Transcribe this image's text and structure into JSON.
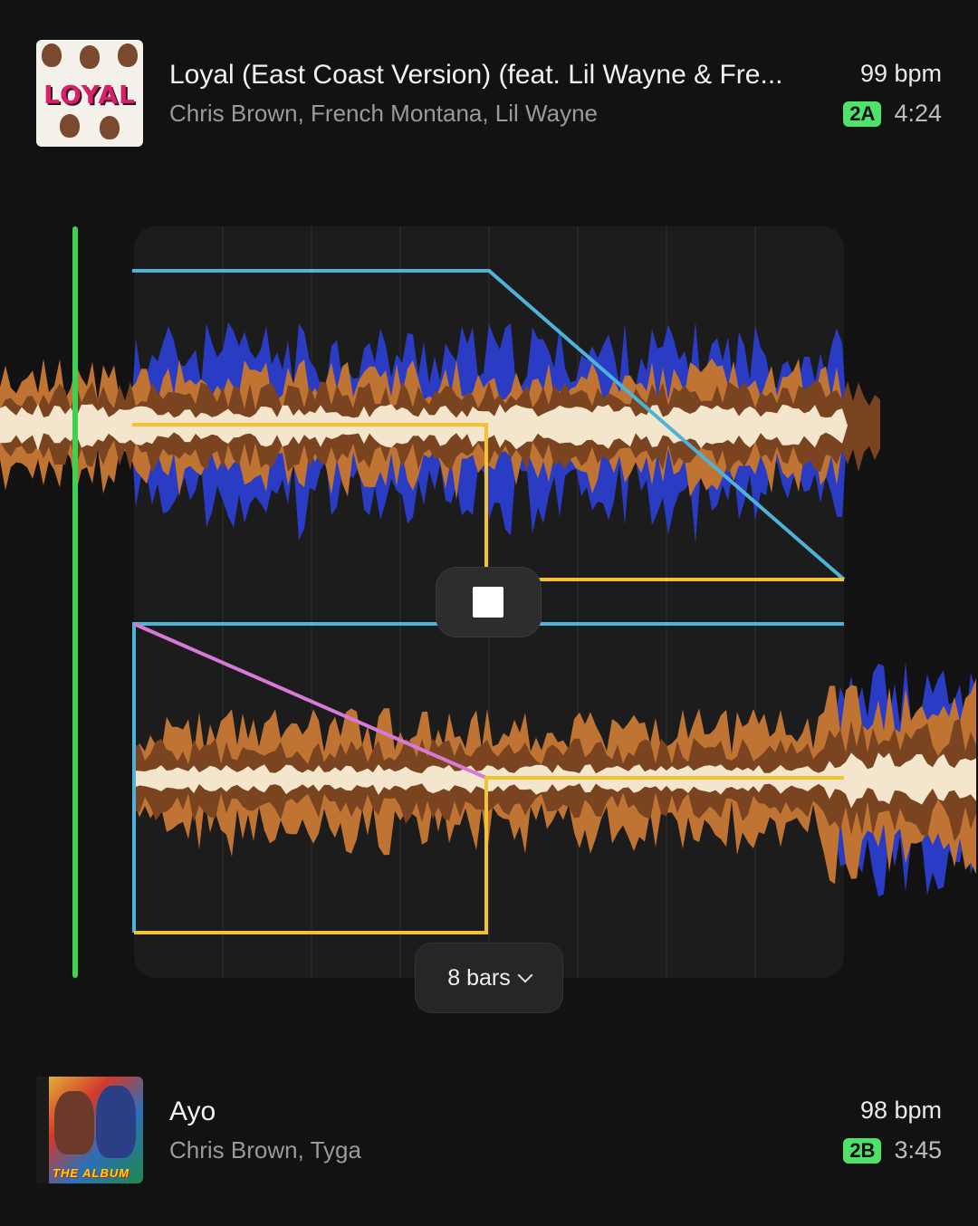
{
  "deck_a": {
    "title": "Loyal (East Coast Version) (feat. Lil Wayne & Fre...",
    "artist": "Chris Brown, French Montana, Lil Wayne",
    "bpm": "99 bpm",
    "key": "2A",
    "duration": "4:24",
    "artwork_text": "LOYAL"
  },
  "deck_b": {
    "title": "Ayo",
    "artist": "Chris Brown, Tyga",
    "bpm": "98 bpm",
    "key": "2B",
    "duration": "3:45",
    "artwork_text": "THE ALBUM"
  },
  "transition": {
    "length_label": "8 bars"
  },
  "controls": {
    "stop_icon": "stop-icon",
    "dropdown_icon": "chevron-down-icon"
  },
  "colors": {
    "background": "#121212",
    "playhead": "#3fd24f",
    "key_badge": "#4ee26b",
    "volume_line": "#4db3d8",
    "eq_line": "#f1c232",
    "filter_line": "#d67ad8",
    "waveform_bass": "#2b3cc4",
    "waveform_mid": "#c07434",
    "waveform_low_mid": "#7b4420",
    "waveform_high": "#f4e6cc"
  }
}
